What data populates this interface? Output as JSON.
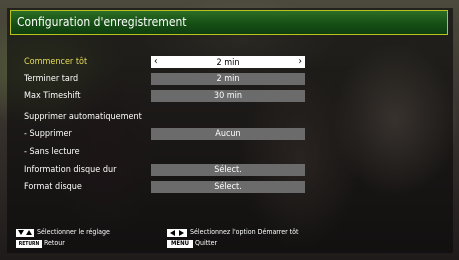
{
  "title": "Configuration d'enregistrement",
  "rows": [
    {
      "label": "Commencer tôt",
      "value": "2 min"
    },
    {
      "label": "Terminer tard",
      "value": "2 min"
    },
    {
      "label": "Max Timeshift",
      "value": "30 min"
    },
    {
      "label": "Supprimer automatiquement",
      "value": ""
    },
    {
      "label": "- Supprimer",
      "value": "Aucun"
    },
    {
      "label": "- Sans lecture",
      "value": ""
    },
    {
      "label": "Information disque dur",
      "value": "Sélect."
    },
    {
      "label": "Format disque",
      "value": "Sélect."
    }
  ],
  "footer": {
    "hint_select": "Sélectionner le réglage",
    "hint_back": "Retour",
    "hint_option": "Sélectionnez l'option Démarrer tôt",
    "hint_quit": "Quitter",
    "key_return": "RETURN",
    "key_menu": "MENU"
  },
  "colors": {
    "accent": "#e8dd58",
    "title_bg": "#165015",
    "title_border": "#b9c21e"
  }
}
